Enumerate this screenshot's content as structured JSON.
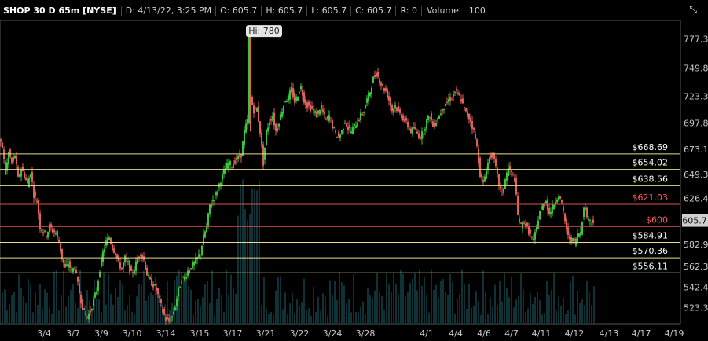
{
  "header": {
    "symbol": "SHOP 30 D 65m [NYSE]",
    "date": "D: 4/13/22, 3:25 PM",
    "open": "O: 605.7",
    "high": "H: 605.7",
    "low": "L: 605.7",
    "close": "C: 605.7",
    "range": "R: 0",
    "volume_label": "Volume",
    "volume_value": "100",
    "tool_icon": "crosshair-cursor-icon"
  },
  "chart_data": {
    "type": "candlestick",
    "title": "SHOP 30 D 65m [NYSE]",
    "ylim": [
      508,
      795
    ],
    "y_ticks": [
      777.37,
      749.89,
      723.39,
      697.83,
      673.17,
      649.38,
      626.43,
      604.26,
      582.94,
      562.34,
      542.47,
      523.3
    ],
    "x_tick_labels": [
      "3/4",
      "3/7",
      "3/9",
      "3/10",
      "3/14",
      "3/15",
      "3/17",
      "3/21",
      "3/22",
      "3/24",
      "3/28",
      "4/1",
      "4/4",
      "4/6",
      "4/7",
      "4/11",
      "4/12",
      "4/13",
      "4/17",
      "4/19"
    ],
    "last_price": 605.7,
    "high_annotation": "Hi: 780",
    "high_value": 780,
    "levels": [
      {
        "label": "$668.69",
        "value": 668.69,
        "color": "#e6dc8c"
      },
      {
        "label": "$654.02",
        "value": 654.02,
        "color": "#e6dc8c"
      },
      {
        "label": "$638.56",
        "value": 638.56,
        "color": "#e6dc8c"
      },
      {
        "label": "$621.03",
        "value": 621.03,
        "color": "#e0504a"
      },
      {
        "label": "$600",
        "value": 600,
        "color": "#e0504a"
      },
      {
        "label": "$584.91",
        "value": 584.91,
        "color": "#e6dc8c"
      },
      {
        "label": "$570.36",
        "value": 570.36,
        "color": "#e6dc8c"
      },
      {
        "label": "$556.11",
        "value": 556.11,
        "color": "#e6dc8c"
      }
    ],
    "price_path": [
      [
        0,
        680
      ],
      [
        4,
        675
      ],
      [
        8,
        650
      ],
      [
        12,
        670
      ],
      [
        16,
        660
      ],
      [
        20,
        668
      ],
      [
        24,
        645
      ],
      [
        28,
        655
      ],
      [
        32,
        648
      ],
      [
        36,
        640
      ],
      [
        40,
        652
      ],
      [
        44,
        630
      ],
      [
        48,
        624
      ],
      [
        52,
        600
      ],
      [
        56,
        595
      ],
      [
        60,
        592
      ],
      [
        64,
        600
      ],
      [
        68,
        596
      ],
      [
        72,
        594
      ],
      [
        76,
        585
      ],
      [
        80,
        570
      ],
      [
        84,
        560
      ],
      [
        88,
        565
      ],
      [
        92,
        558
      ],
      [
        96,
        562
      ],
      [
        100,
        545
      ],
      [
        104,
        530
      ],
      [
        108,
        518
      ],
      [
        112,
        515
      ],
      [
        116,
        520
      ],
      [
        120,
        530
      ],
      [
        124,
        540
      ],
      [
        128,
        560
      ],
      [
        132,
        575
      ],
      [
        136,
        585
      ],
      [
        140,
        590
      ],
      [
        144,
        580
      ],
      [
        148,
        575
      ],
      [
        152,
        565
      ],
      [
        156,
        560
      ],
      [
        160,
        570
      ],
      [
        164,
        565
      ],
      [
        168,
        555
      ],
      [
        172,
        560
      ],
      [
        176,
        570
      ],
      [
        180,
        575
      ],
      [
        184,
        568
      ],
      [
        188,
        555
      ],
      [
        192,
        548
      ],
      [
        196,
        545
      ],
      [
        200,
        540
      ],
      [
        204,
        530
      ],
      [
        208,
        520
      ],
      [
        212,
        512
      ],
      [
        216,
        510
      ],
      [
        220,
        515
      ],
      [
        224,
        525
      ],
      [
        228,
        540
      ],
      [
        232,
        550
      ],
      [
        236,
        552
      ],
      [
        240,
        558
      ],
      [
        244,
        562
      ],
      [
        248,
        565
      ],
      [
        252,
        570
      ],
      [
        256,
        575
      ],
      [
        260,
        590
      ],
      [
        264,
        600
      ],
      [
        268,
        620
      ],
      [
        272,
        625
      ],
      [
        276,
        630
      ],
      [
        280,
        640
      ],
      [
        284,
        648
      ],
      [
        288,
        655
      ],
      [
        292,
        660
      ],
      [
        296,
        658
      ],
      [
        300,
        662
      ],
      [
        304,
        665
      ],
      [
        308,
        668
      ],
      [
        312,
        690
      ],
      [
        316,
        700
      ],
      [
        318,
        780
      ],
      [
        320,
        720
      ],
      [
        324,
        710
      ],
      [
        328,
        712
      ],
      [
        332,
        690
      ],
      [
        336,
        660
      ],
      [
        340,
        690
      ],
      [
        344,
        700
      ],
      [
        348,
        705
      ],
      [
        352,
        690
      ],
      [
        356,
        700
      ],
      [
        360,
        710
      ],
      [
        364,
        720
      ],
      [
        368,
        722
      ],
      [
        372,
        730
      ],
      [
        376,
        718
      ],
      [
        380,
        725
      ],
      [
        384,
        732
      ],
      [
        388,
        720
      ],
      [
        392,
        715
      ],
      [
        396,
        712
      ],
      [
        400,
        710
      ],
      [
        404,
        705
      ],
      [
        408,
        712
      ],
      [
        412,
        708
      ],
      [
        416,
        700
      ],
      [
        420,
        705
      ],
      [
        424,
        695
      ],
      [
        428,
        688
      ],
      [
        432,
        685
      ],
      [
        436,
        690
      ],
      [
        440,
        700
      ],
      [
        444,
        693
      ],
      [
        448,
        690
      ],
      [
        452,
        695
      ],
      [
        456,
        700
      ],
      [
        460,
        705
      ],
      [
        464,
        710
      ],
      [
        468,
        720
      ],
      [
        472,
        728
      ],
      [
        476,
        740
      ],
      [
        480,
        745
      ],
      [
        484,
        738
      ],
      [
        488,
        732
      ],
      [
        492,
        728
      ],
      [
        496,
        720
      ],
      [
        500,
        710
      ],
      [
        504,
        715
      ],
      [
        508,
        708
      ],
      [
        512,
        705
      ],
      [
        516,
        700
      ],
      [
        520,
        695
      ],
      [
        524,
        690
      ],
      [
        528,
        693
      ],
      [
        532,
        688
      ],
      [
        536,
        685
      ],
      [
        540,
        690
      ],
      [
        544,
        700
      ],
      [
        548,
        705
      ],
      [
        552,
        695
      ],
      [
        556,
        700
      ],
      [
        560,
        705
      ],
      [
        564,
        712
      ],
      [
        568,
        715
      ],
      [
        572,
        720
      ],
      [
        576,
        722
      ],
      [
        580,
        728
      ],
      [
        584,
        725
      ],
      [
        588,
        720
      ],
      [
        592,
        710
      ],
      [
        596,
        705
      ],
      [
        600,
        700
      ],
      [
        604,
        690
      ],
      [
        608,
        675
      ],
      [
        612,
        650
      ],
      [
        616,
        640
      ],
      [
        620,
        655
      ],
      [
        624,
        665
      ],
      [
        628,
        668
      ],
      [
        632,
        655
      ],
      [
        636,
        640
      ],
      [
        640,
        630
      ],
      [
        644,
        645
      ],
      [
        648,
        655
      ],
      [
        652,
        650
      ],
      [
        656,
        645
      ],
      [
        660,
        610
      ],
      [
        664,
        600
      ],
      [
        668,
        605
      ],
      [
        672,
        598
      ],
      [
        676,
        592
      ],
      [
        680,
        585
      ],
      [
        684,
        600
      ],
      [
        688,
        615
      ],
      [
        692,
        620
      ],
      [
        696,
        625
      ],
      [
        700,
        612
      ],
      [
        704,
        618
      ],
      [
        708,
        625
      ],
      [
        712,
        630
      ],
      [
        716,
        620
      ],
      [
        720,
        605
      ],
      [
        724,
        590
      ],
      [
        728,
        588
      ],
      [
        732,
        585
      ],
      [
        736,
        592
      ],
      [
        740,
        595
      ],
      [
        744,
        620
      ],
      [
        748,
        610
      ],
      [
        752,
        605
      ],
      [
        756,
        606
      ]
    ]
  }
}
